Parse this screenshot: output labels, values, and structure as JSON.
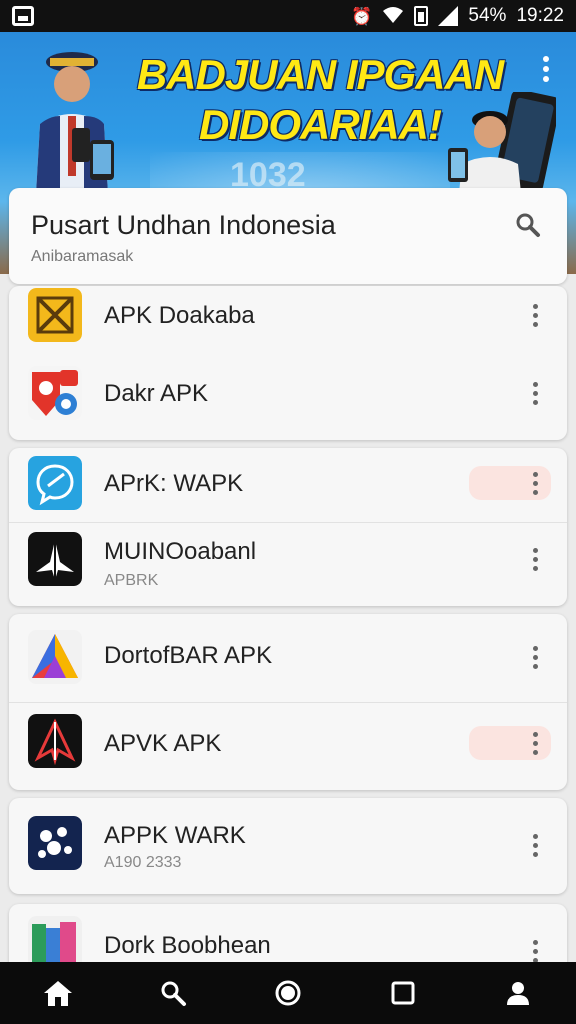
{
  "status_bar": {
    "battery": "54%",
    "time": "19:22",
    "icons": [
      "screenshot-icon",
      "alarm-icon",
      "wifi-icon",
      "battery-saver-icon",
      "signal-icon"
    ]
  },
  "banner": {
    "title_line1": "BADJUAN IPGAAN",
    "title_line2": "DIDOARIAA!",
    "subtitle": "1032",
    "colors": {
      "title": "#ffe814",
      "background": "#2f9be6"
    }
  },
  "header": {
    "title": "Pusart Undhan Indonesia",
    "subtitle": "Anibaramasak"
  },
  "groups": [
    {
      "items": [
        {
          "title": "APK Doakaba",
          "subtitle": "",
          "icon": "cross-square-app-icon",
          "highlight": false
        },
        {
          "title": "Dakr APK",
          "subtitle": "",
          "icon": "map-chat-app-icon",
          "highlight": false
        }
      ]
    },
    {
      "items": [
        {
          "title": "APrK: WAPK",
          "subtitle": "",
          "icon": "chat-bubble-app-icon",
          "highlight": true
        },
        {
          "title": "MUINOoabanl",
          "subtitle": "APBRK",
          "icon": "paper-plane-app-icon",
          "highlight": false
        }
      ]
    },
    {
      "items": [
        {
          "title": "DortofBAR APK",
          "subtitle": "",
          "icon": "triangle-logo-app-icon",
          "highlight": false
        },
        {
          "title": "APVK APK",
          "subtitle": "",
          "icon": "red-arrow-app-icon",
          "highlight": true
        }
      ]
    },
    {
      "items": [
        {
          "title": "APPK WARK",
          "subtitle": "A190 2333",
          "icon": "dots-logo-app-icon",
          "highlight": false
        }
      ]
    },
    {
      "items": [
        {
          "title": "Dork Boobhean",
          "subtitle": "",
          "icon": "books-app-icon",
          "highlight": false
        }
      ]
    }
  ],
  "nav": [
    "home-icon",
    "search-icon",
    "circle-icon",
    "square-icon",
    "profile-icon"
  ]
}
